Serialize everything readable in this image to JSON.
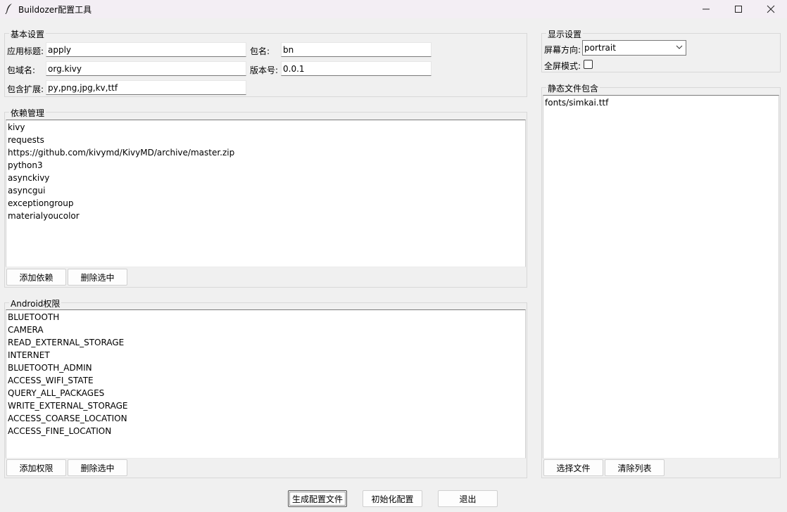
{
  "window": {
    "title": "Buildozer配置工具",
    "minimize_icon": "minimize-icon",
    "maximize_icon": "maximize-icon",
    "close_icon": "close-icon"
  },
  "basic": {
    "title": "基本设置",
    "app_title_label": "应用标题:",
    "app_title_value": "apply",
    "package_name_label": "包名:",
    "package_name_value": "bn",
    "package_domain_label": "包域名:",
    "package_domain_value": "org.kivy",
    "version_label": "版本号:",
    "version_value": "0.0.1",
    "include_exts_label": "包含扩展:",
    "include_exts_value": "py,png,jpg,kv,ttf"
  },
  "deps": {
    "title": "依赖管理",
    "items": [
      "kivy",
      "requests",
      "https://github.com/kivymd/KivyMD/archive/master.zip",
      "python3",
      "asynckivy",
      "asyncgui",
      "exceptiongroup",
      "materialyoucolor"
    ],
    "add_label": "添加依赖",
    "delete_label": "删除选中"
  },
  "perms": {
    "title": "Android权限",
    "items": [
      "BLUETOOTH",
      "CAMERA",
      "READ_EXTERNAL_STORAGE",
      "INTERNET",
      "BLUETOOTH_ADMIN",
      "ACCESS_WIFI_STATE",
      "QUERY_ALL_PACKAGES",
      "WRITE_EXTERNAL_STORAGE",
      "ACCESS_COARSE_LOCATION",
      "ACCESS_FINE_LOCATION"
    ],
    "add_label": "添加权限",
    "delete_label": "删除选中"
  },
  "display": {
    "title": "显示设置",
    "orientation_label": "屏幕方向:",
    "orientation_value": "portrait",
    "fullscreen_label": "全屏模式:",
    "fullscreen_checked": false
  },
  "static_files": {
    "title": "静态文件包含",
    "items": [
      "fonts/simkai.ttf"
    ],
    "select_label": "选择文件",
    "clear_label": "清除列表"
  },
  "footer": {
    "generate_label": "生成配置文件",
    "init_label": "初始化配置",
    "exit_label": "退出"
  }
}
